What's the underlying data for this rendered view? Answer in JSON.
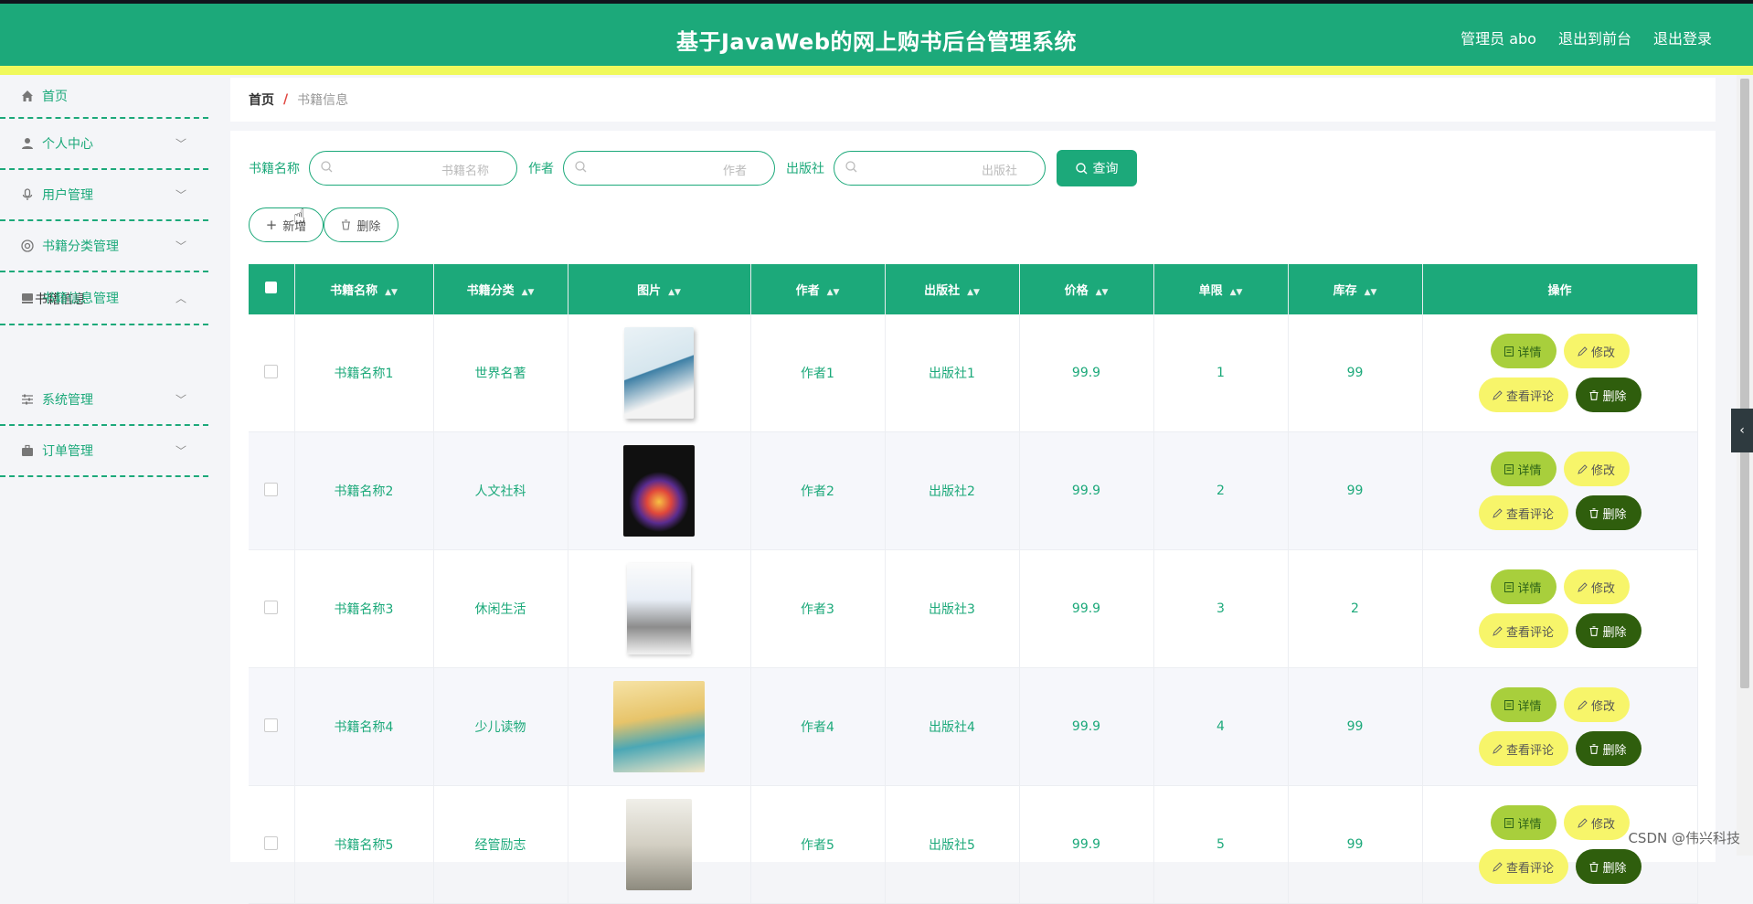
{
  "header": {
    "title": "基于JavaWeb的网上购书后台管理系统",
    "admin_label": "管理员 abo",
    "exit_front": "退出到前台",
    "logout": "退出登录"
  },
  "sidebar": {
    "items": [
      {
        "label": "首页",
        "icon": "home-icon"
      },
      {
        "label": "个人中心",
        "icon": "user-icon"
      },
      {
        "label": "用户管理",
        "icon": "mic-icon"
      },
      {
        "label": "书籍分类管理",
        "icon": "lifebuoy-icon"
      },
      {
        "label": "书籍信息管理",
        "icon": "book-icon"
      },
      {
        "label": "系统管理",
        "icon": "sliders-icon"
      },
      {
        "label": "订单管理",
        "icon": "briefcase-icon"
      }
    ],
    "sub_item": "书籍信息"
  },
  "breadcrumb": {
    "home": "首页",
    "separator": "/",
    "current": "书籍信息"
  },
  "search": {
    "name_label": "书籍名称",
    "name_placeholder": "书籍名称",
    "author_label": "作者",
    "author_placeholder": "作者",
    "publisher_label": "出版社",
    "publisher_placeholder": "出版社",
    "query_button": "查询"
  },
  "actions": {
    "add_button": "新增",
    "delete_button": "删除"
  },
  "table": {
    "columns": [
      "书籍名称",
      "书籍分类",
      "图片",
      "作者",
      "出版社",
      "价格",
      "单限",
      "库存",
      "操作"
    ],
    "rows": [
      {
        "name": "书籍名称1",
        "category": "世界名著",
        "author": "作者1",
        "publisher": "出版社1",
        "price": "99.9",
        "limit": "1",
        "stock": "99"
      },
      {
        "name": "书籍名称2",
        "category": "人文社科",
        "author": "作者2",
        "publisher": "出版社2",
        "price": "99.9",
        "limit": "2",
        "stock": "99"
      },
      {
        "name": "书籍名称3",
        "category": "休闲生活",
        "author": "作者3",
        "publisher": "出版社3",
        "price": "99.9",
        "limit": "3",
        "stock": "2"
      },
      {
        "name": "书籍名称4",
        "category": "少儿读物",
        "author": "作者4",
        "publisher": "出版社4",
        "price": "99.9",
        "limit": "4",
        "stock": "99"
      },
      {
        "name": "书籍名称5",
        "category": "经管励志",
        "author": "作者5",
        "publisher": "出版社5",
        "price": "99.9",
        "limit": "5",
        "stock": "99"
      }
    ],
    "ops": {
      "detail": "详情",
      "edit": "修改",
      "review": "查看评论",
      "delete": "删除"
    }
  },
  "watermark": "CSDN @伟兴科技",
  "colors": {
    "primary": "#1ca97a",
    "stripe": "#f0f95c",
    "detail": "#a8cf3c",
    "edit": "#f7f56a",
    "delete": "#2f5e0d"
  }
}
